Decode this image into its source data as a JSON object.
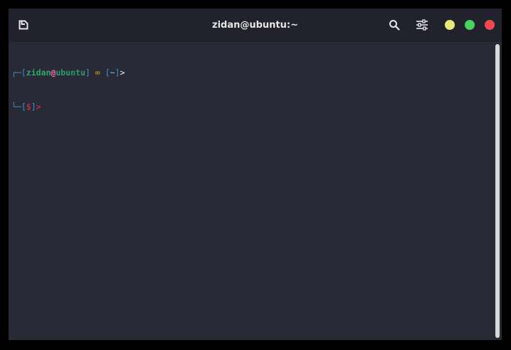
{
  "window": {
    "title": "zidan@ubuntu:~"
  },
  "toolbar": {
    "new_tab_icon": "new-tab-icon",
    "search_icon": "search-icon",
    "preferences_icon": "sliders-icon"
  },
  "window_controls": {
    "minimize_color": "#e8e87a",
    "maximize_color": "#4ad25f",
    "close_color": "#ec4a4d"
  },
  "prompt": {
    "line1_corner": "┌─",
    "open_bracket": "[",
    "user": "zidan",
    "at": "@",
    "host": "ubuntu",
    "close_bracket": "]",
    "infinity": " ∞ ",
    "dir_open": "[",
    "cwd": "~",
    "dir_close": "]",
    "arrow": ">",
    "line2_corner": "└─",
    "dollar_open": "[",
    "dollar": "$",
    "dollar_close": "]",
    "arrow2": ">"
  },
  "colors": {
    "bracket_blue": "#3d8fd0",
    "user_green": "#31a66a",
    "host_green": "#2f9a6a",
    "at_pink": "#f26bb2",
    "infinity_yellow": "#c9a227",
    "cwd_cyan": "#7bd0e8",
    "arrow_white": "#f0f0f0",
    "dollar_red": "#e6304a"
  }
}
